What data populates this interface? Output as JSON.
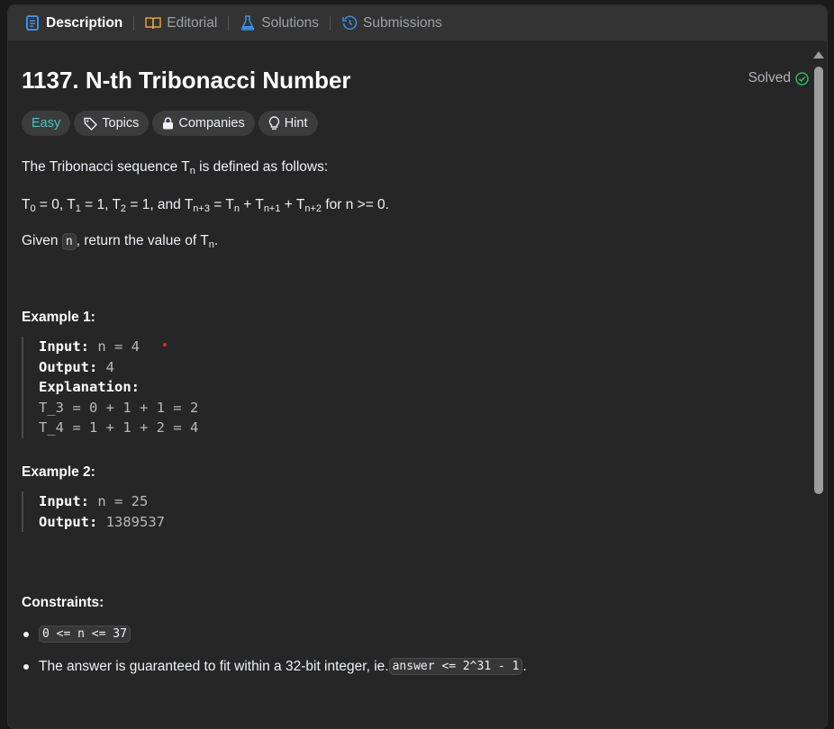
{
  "tabs": [
    {
      "label": "Description",
      "icon": "description-icon"
    },
    {
      "label": "Editorial",
      "icon": "book-icon"
    },
    {
      "label": "Solutions",
      "icon": "flask-icon"
    },
    {
      "label": "Submissions",
      "icon": "history-icon"
    }
  ],
  "problem": {
    "title": "1137. N-th Tribonacci Number",
    "status": "Solved",
    "tags": {
      "difficulty": "Easy",
      "topics": "Topics",
      "companies": "Companies",
      "hint": "Hint"
    },
    "desc": {
      "line1_pre": "The Tribonacci sequence T",
      "line1_sub": "n",
      "line1_post": " is defined as follows:",
      "line2": {
        "t0": "T",
        "t0s": "0",
        "t0v": " = 0, ",
        "t1": "T",
        "t1s": "1",
        "t1v": " = 1, ",
        "t2": "T",
        "t2s": "2",
        "t2v": " = 1, and ",
        "t3": "T",
        "t3s": "n+3",
        "eq": " = ",
        "t4": "T",
        "t4s": "n",
        "p1": " + ",
        "t5": "T",
        "t5s": "n+1",
        "p2": " + ",
        "t6": "T",
        "t6s": "n+2",
        "tail": " for n >= 0."
      },
      "line3_pre": "Given ",
      "line3_code": "n",
      "line3_mid": ", return the value of T",
      "line3_sub": "n",
      "line3_post": "."
    },
    "example1": {
      "heading": "Example 1:",
      "input_k": "Input:",
      "input_v": " n = 4",
      "output_k": "Output:",
      "output_v": " 4",
      "expl_k": "Explanation:",
      "expl_l1": "T_3 = 0 + 1 + 1 = 2",
      "expl_l2": "T_4 = 1 + 1 + 2 = 4"
    },
    "example2": {
      "heading": "Example 2:",
      "input_k": "Input:",
      "input_v": " n = 25",
      "output_k": "Output:",
      "output_v": " 1389537"
    },
    "constraints": {
      "heading": "Constraints:",
      "c1_code": "0 <= n <= 37",
      "c2_text": "The answer is guaranteed to fit within a 32-bit integer, ie. ",
      "c2_code": "answer <= 2^31 - 1",
      "c2_end": "."
    }
  },
  "colors": {
    "easy": "#46c6c2",
    "solved": "#2cbb5d",
    "bg": "#262626"
  }
}
